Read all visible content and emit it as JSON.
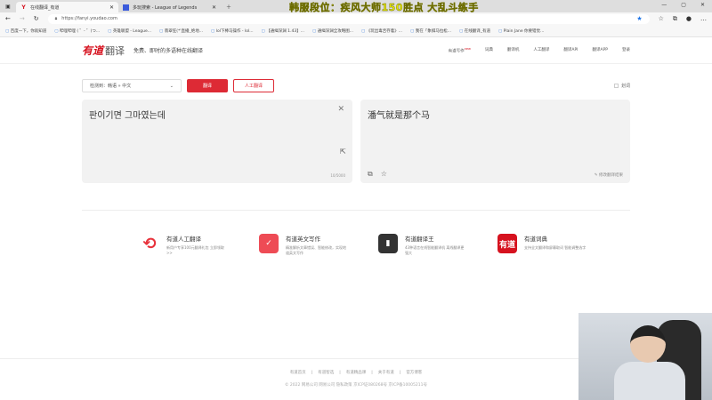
{
  "stream_title": "韩服段位：疾风大师150胜点 大乱斗练手",
  "browser": {
    "tabs": [
      {
        "label": "在线翻译_有道",
        "active": true
      },
      {
        "label": "多玩搜索 - League of Legends",
        "active": false
      }
    ],
    "url": "https://fanyi.youdao.com",
    "bookmarks": [
      "百度一下，你就知道",
      "哔哩哔哩 ( ゜- ゜)つ...",
      "英雄联盟 - League...",
      "翡翠狂(*'直播_绝地...",
      "lol下棒马操作 - lol...",
      "【通缉深渊 1.43】...",
      "通缉深渊全攻略图...",
      "《玩出毒舌存着》...",
      "我在「象棋马拉松...",
      "在线翻译_有道",
      "Plain Jane 你要错觉..."
    ]
  },
  "header": {
    "logo": "有道",
    "logo_suffix": "翻译",
    "slogan": "免费、即时的多语种在线翻译",
    "nav": [
      {
        "label": "有道写作",
        "badge": "new"
      },
      {
        "label": "词典"
      },
      {
        "label": "翻译机"
      },
      {
        "label": "人工翻译"
      },
      {
        "label": "翻译API"
      },
      {
        "label": "翻译APP"
      },
      {
        "label": "登录"
      }
    ]
  },
  "toolbar": {
    "language": "检测到：韩语 » 中文",
    "translate": "翻译",
    "human": "人工翻译",
    "dict": "划词"
  },
  "source": {
    "text": "판이기면 그마였는데",
    "count": "10/5000"
  },
  "target": {
    "text": "潘气就是那个马",
    "edit": "修改翻译结果"
  },
  "cards": [
    {
      "title": "有道人工翻译",
      "desc": "新用户专享100元翻译礼包 立即领取 >>",
      "color": "#e8333c"
    },
    {
      "title": "有道英文写作",
      "desc": "精准解析文章错误、智能修改，实现地道英文写作",
      "color": "#ee4b55"
    },
    {
      "title": "有道翻译王",
      "desc": "43种语言在线智能翻译机 离线翻译更强大",
      "color": "#333333"
    },
    {
      "title": "有道词典",
      "desc": "支持全文翻译和屏幕取词 智能调整选字",
      "color": "#d6121f",
      "icon_text": "有道"
    }
  ],
  "footer": {
    "links": [
      "有道首页",
      "有道智选",
      "有道精品课",
      "关于有道",
      "官方博客"
    ],
    "copyright": "© 2022 网易公司 网易公司 隐私政策 京ICP证080268号 京ICP备10005211号"
  }
}
